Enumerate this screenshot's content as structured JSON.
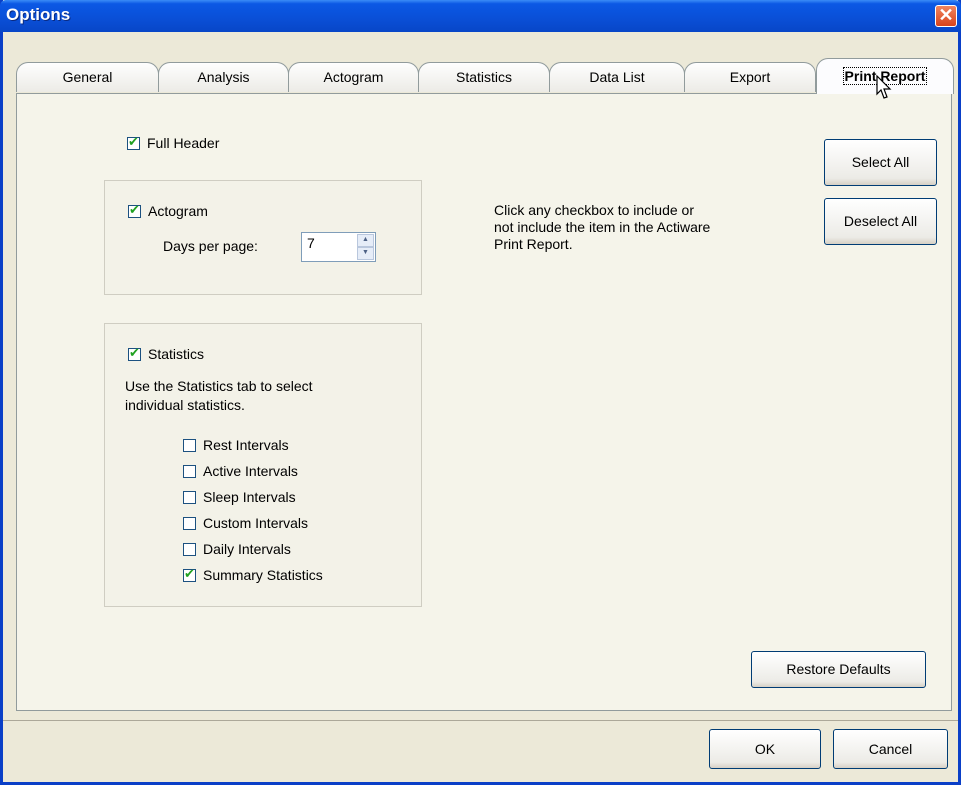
{
  "window": {
    "title": "Options",
    "close_glyph": "✕"
  },
  "tabs": [
    "General",
    "Analysis",
    "Actogram",
    "Statistics",
    "Data List",
    "Export",
    "Print Report"
  ],
  "active_tab": "Print Report",
  "full_header": {
    "label": "Full Header",
    "checked": true
  },
  "actogram": {
    "label": "Actogram",
    "checked": true,
    "days_label": "Days per page:",
    "days_value": "7"
  },
  "statistics": {
    "label": "Statistics",
    "checked": true,
    "hint_line1": "Use the Statistics tab to select",
    "hint_line2": "individual statistics.",
    "items": [
      {
        "label": "Rest Intervals",
        "checked": false
      },
      {
        "label": "Active Intervals",
        "checked": false
      },
      {
        "label": "Sleep Intervals",
        "checked": false
      },
      {
        "label": "Custom Intervals",
        "checked": false
      },
      {
        "label": "Daily Intervals",
        "checked": false
      },
      {
        "label": "Summary Statistics",
        "checked": true
      }
    ]
  },
  "info": {
    "line1": "Click any checkbox to include or",
    "line2": "not include the item in the Actiware",
    "line3": "Print Report."
  },
  "buttons": {
    "select_all": "Select All",
    "deselect_all": "Deselect All",
    "restore_defaults": "Restore Defaults",
    "ok": "OK",
    "cancel": "Cancel"
  },
  "colors": {
    "titlebar": "#0a50d8",
    "face": "#ece9d8",
    "check": "#21a121"
  }
}
